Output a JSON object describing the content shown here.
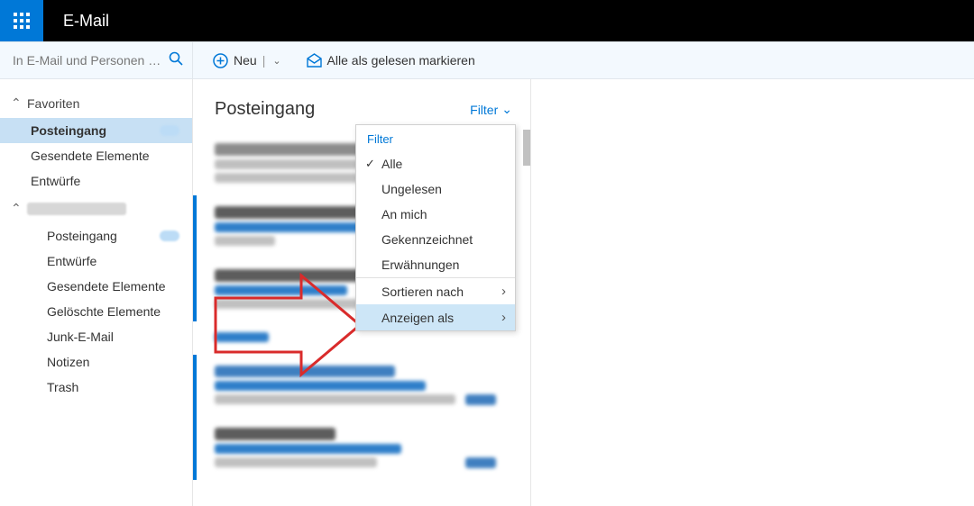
{
  "header": {
    "app_title": "E-Mail"
  },
  "search": {
    "placeholder": "In E-Mail und Personen s…"
  },
  "toolbar": {
    "new_label": "Neu",
    "markread_label": "Alle als gelesen markieren"
  },
  "sidebar": {
    "favorites_label": "Favoriten",
    "favorites": [
      {
        "label": "Posteingang",
        "selected": true,
        "badge": true
      },
      {
        "label": "Gesendete Elemente"
      },
      {
        "label": "Entwürfe"
      }
    ],
    "account_items": [
      {
        "label": "Posteingang",
        "badge": true
      },
      {
        "label": "Entwürfe"
      },
      {
        "label": "Gesendete Elemente"
      },
      {
        "label": "Gelöschte Elemente"
      },
      {
        "label": "Junk-E-Mail"
      },
      {
        "label": "Notizen"
      },
      {
        "label": "Trash"
      }
    ]
  },
  "list": {
    "title": "Posteingang",
    "filter_label": "Filter"
  },
  "dropdown": {
    "header": "Filter",
    "items": [
      {
        "label": "Alle",
        "checked": true
      },
      {
        "label": "Ungelesen"
      },
      {
        "label": "An mich"
      },
      {
        "label": "Gekennzeichnet"
      },
      {
        "label": "Erwähnungen"
      },
      {
        "label": "Sortieren nach",
        "submenu": true,
        "sep": true
      },
      {
        "label": "Anzeigen als",
        "submenu": true,
        "highlight": true
      }
    ]
  }
}
